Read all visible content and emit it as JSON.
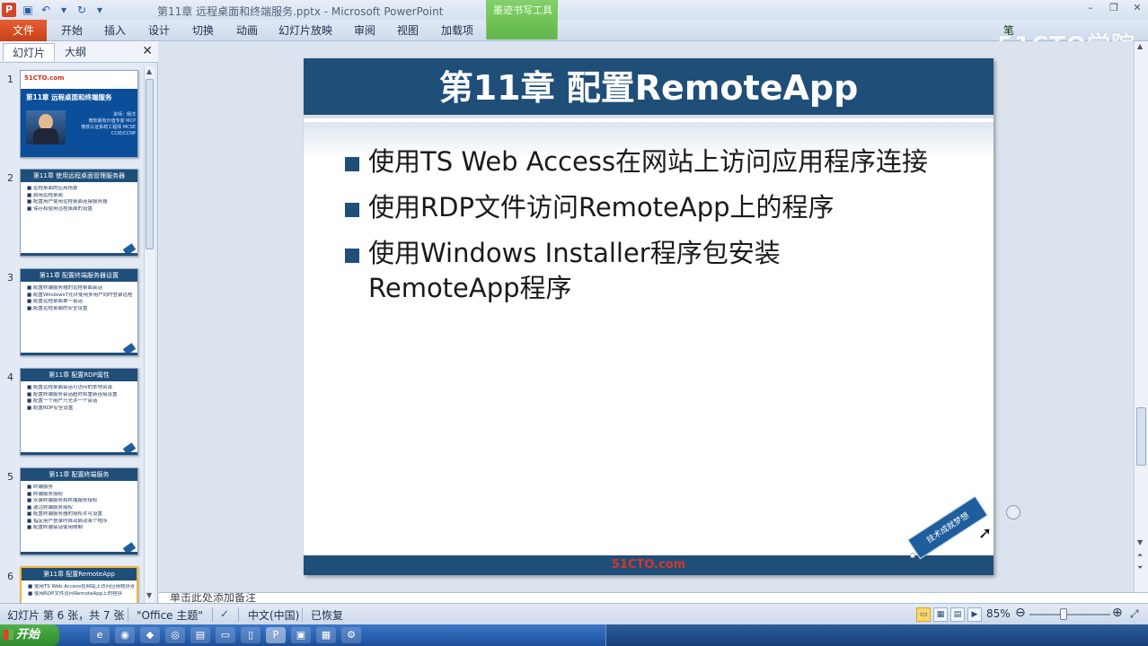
{
  "window": {
    "title": "第11章 远程桌面和终端服务.pptx - Microsoft PowerPoint",
    "context_tab_title": "墨迹书写工具"
  },
  "ribbon": {
    "tabs": [
      {
        "label": "文件"
      },
      {
        "label": "开始"
      },
      {
        "label": "插入"
      },
      {
        "label": "设计"
      },
      {
        "label": "切换"
      },
      {
        "label": "动画"
      },
      {
        "label": "幻灯片放映"
      },
      {
        "label": "审阅"
      },
      {
        "label": "视图"
      },
      {
        "label": "加载项"
      },
      {
        "label": "笔"
      }
    ]
  },
  "watermark": "51CTO学院",
  "left_panel": {
    "tab_slides": "幻灯片",
    "tab_outline": "大纲",
    "close": "✕",
    "thumbnails": [
      {
        "num": "1",
        "logo": "51CTO.com",
        "title": "第11章 远程桌面和终端服务",
        "info": [
          "讲师：杨洋",
          "微软最有价值专家 MCP",
          "微软认证系统工程师 MCSE",
          "CCIE/CCNP"
        ]
      },
      {
        "num": "2",
        "title": "第11章 使用远程桌面管理服务器",
        "lines": [
          "■ 远程桌面的应用场景",
          "■ 启用远程桌面",
          "■ 配置用户使用远程桌面连接服务器",
          "■ 保存和使用远程桌面的设置"
        ]
      },
      {
        "num": "3",
        "title": "第11章 配置终端服务器设置",
        "lines": [
          "■ 配置终端服务器的远程桌面会话",
          "■ 配置Windows7允许使用多用户同时登录远程桌面",
          "■ 配置远程桌面单一会话",
          "■ 配置远程桌面的安全设置"
        ]
      },
      {
        "num": "4",
        "title": "第11章 配置RDP属性",
        "lines": [
          "■ 配置远程桌面会话可访问的本地资源",
          "■ 配置终端服务会话超时和重新连接设置",
          "■ 配置一个用户只允许一个会话",
          "■ 配置RDP安全设置"
        ]
      },
      {
        "num": "5",
        "title": "第11章 配置终端服务",
        "lines": [
          "■ 终端服务",
          "■ 终端服务授权",
          "■ 安装终端服务和终端服务授权",
          "■ 激活终端服务授权",
          "■ 配置终端服务器的授权许可设置",
          "■ 指定用户登录时自动启动某个程序",
          "■ 配置终端会话使用限制"
        ]
      },
      {
        "num": "6",
        "title": "第11章 配置RemoteApp",
        "lines": [
          "■ 使用TS Web Access在网站上访问应用程序连接",
          "■ 使用RDP文件访问RemoteApp上的程序"
        ]
      }
    ]
  },
  "slide": {
    "title": "第11章 配置RemoteApp",
    "bullets": [
      "使用TS Web Access在网站上访问应用程序连接",
      "使用RDP文件访问RemoteApp上的程序",
      "使用Windows Installer程序包安装RemoteApp程序"
    ],
    "footer_logo": "51CTO.com",
    "ribbon_tag": "技术成就梦想"
  },
  "notes": {
    "placeholder": "单击此处添加备注"
  },
  "status": {
    "slide_info": "幻灯片 第 6 张，共 7 张",
    "theme": "\"Office 主题\"",
    "language": "中文(中国)",
    "restored": "已恢复",
    "zoom": "85%",
    "zoom_value": 0.85
  },
  "taskbar": {
    "start": "开始"
  }
}
